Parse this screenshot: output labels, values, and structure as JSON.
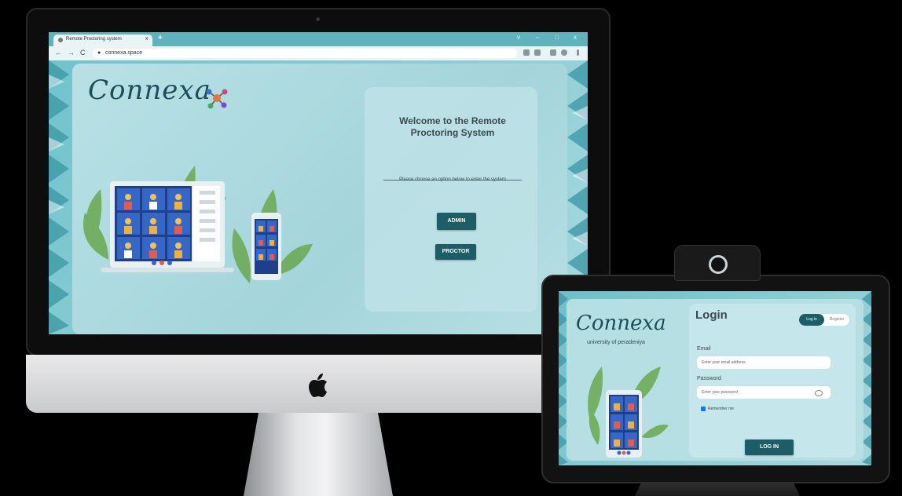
{
  "desktop": {
    "browser": {
      "tab_title": "Remote Proctoring system",
      "tab_close": "x",
      "new_tab": "+",
      "window_controls": [
        "v",
        "–",
        "□",
        "x"
      ],
      "nav": {
        "back": "←",
        "forward": "→",
        "reload": "C"
      },
      "url": "connexa.space"
    },
    "page": {
      "logo": "Connexa",
      "welcome_title": "Welcome to the Remote Proctoring System",
      "instruction": "Please choose an option below to enter the system",
      "admin_button": "ADMIN",
      "proctor_button": "PROCTOR"
    }
  },
  "tablet": {
    "logo": "Connexa",
    "university": "university of peradeniya",
    "login_title": "Login",
    "toggle_login": "Log in",
    "toggle_register": "Register",
    "email_label": "Email",
    "email_placeholder": "Enter your email address",
    "password_label": "Password",
    "password_placeholder": "Enter your password",
    "remember_me": "Remember me",
    "remember_checked": true,
    "login_button": "LOG IN"
  },
  "colors": {
    "accent": "#1d5d66",
    "background": "#a6d8dd",
    "logo": "#1c4e59"
  }
}
